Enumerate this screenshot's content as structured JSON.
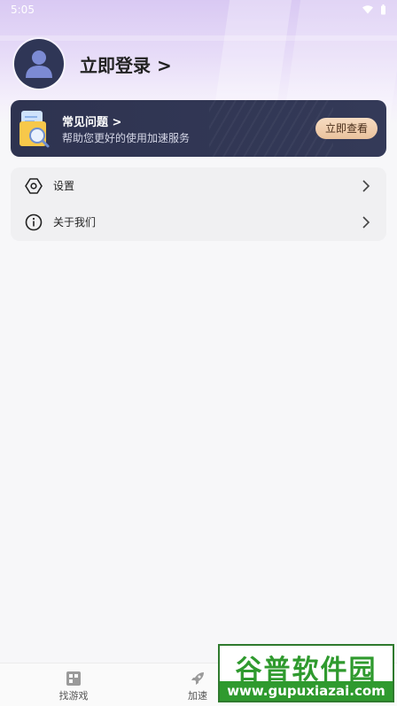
{
  "status_bar": {
    "time": "5:05"
  },
  "profile": {
    "login_label": "立即登录 >"
  },
  "faq": {
    "title": "常见问题 >",
    "subtitle": "帮助您更好的使用加速服务",
    "button_label": "立即查看"
  },
  "menu": {
    "items": [
      {
        "label": "设置",
        "icon": "hexagon-settings-icon"
      },
      {
        "label": "关于我们",
        "icon": "info-icon"
      }
    ]
  },
  "bottom_nav": {
    "items": [
      {
        "label": "找游戏",
        "icon": "game-grid-icon"
      },
      {
        "label": "加速",
        "icon": "rocket-icon"
      }
    ]
  },
  "watermark": {
    "main": "谷普软件园",
    "url": "www.gupuxiazai.com"
  },
  "colors": {
    "header_gradient": "#d9c9f3",
    "faq_card": "#2e3350",
    "faq_button": "#eac29d",
    "avatar": "#2f3656",
    "watermark_green": "#2f9a2e"
  }
}
